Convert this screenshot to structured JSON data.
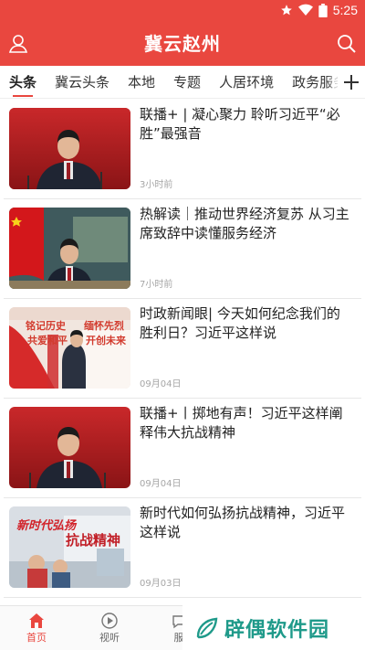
{
  "status_bar": {
    "time": "5:25"
  },
  "app_bar": {
    "title": "冀云赵州"
  },
  "tabs": [
    "头条",
    "冀云头条",
    "本地",
    "专题",
    "人居环境",
    "政务服务"
  ],
  "news": [
    {
      "title": "联播+ | 凝心聚力 聆听习近平“必胜”最强音",
      "time": "3小时前"
    },
    {
      "title": "热解读｜推动世界经济复苏 从习主席致辞中读懂服务经济",
      "time": "7小时前"
    },
    {
      "title": "时政新闻眼| 今天如何纪念我们的胜利日？习近平这样说",
      "time": "09月04日"
    },
    {
      "title": "联播+丨掷地有声！习近平这样阐释伟大抗战精神",
      "time": "09月04日"
    },
    {
      "title": "新时代如何弘扬抗战精神，习近平这样说",
      "time": "09月03日"
    }
  ],
  "thumb_texts": {
    "n3_left": "铭记历史",
    "n3_left2": "共爱和平",
    "n3_right": "缅怀先烈",
    "n3_right2": "开创未来",
    "n5_a": "新时代弘扬",
    "n5_b": "抗战精神"
  },
  "bottom_nav": [
    "首页",
    "视听",
    "服"
  ],
  "watermark": "辟偶软件园",
  "colors": {
    "brand": "#e9473f",
    "watermark": "#1f9a8a"
  }
}
